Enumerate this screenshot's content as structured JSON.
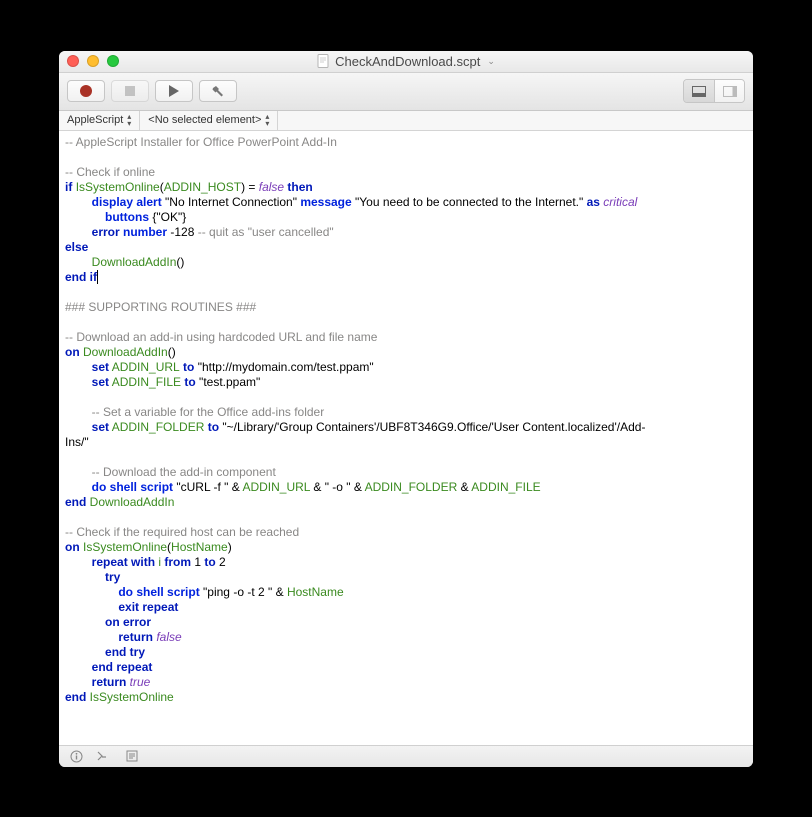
{
  "window": {
    "title": "CheckAndDownload.scpt"
  },
  "subbar": {
    "language": "AppleScript",
    "element": "<No selected element>"
  },
  "code": {
    "l1": "-- AppleScript Installer for Office PowerPoint Add-In",
    "l2": "",
    "l3": "-- Check if online",
    "l4_if": "if",
    "l4_fn": "IsSystemOnline",
    "l4_lp": "(",
    "l4_arg": "ADDIN_HOST",
    "l4_rp": ") = ",
    "l4_false": "false",
    "l4_then": " then",
    "l5_da": "display alert",
    "l5_s1": " \"No Internet Connection\" ",
    "l5_msg": "message",
    "l5_s2": " \"You need to be connected to the Internet.\" ",
    "l5_as": "as",
    "l5_crit": " critical",
    "l6_btn": "buttons",
    "l6_s": " {\"OK\"}",
    "l7_err": "error",
    "l7_num": " number",
    "l7_v": " -128 ",
    "l7_c": "-- quit as \"user cancelled\"",
    "l8": "else",
    "l9_fn": "DownloadAddIn",
    "l9_p": "()",
    "l10": "end if",
    "l11": "",
    "l12": "### SUPPORTING ROUTINES ###",
    "l13": "",
    "l14": "-- Download an add-in using hardcoded URL and file name",
    "l15_on": "on",
    "l15_fn": " DownloadAddIn",
    "l15_p": "()",
    "l16_set": "set",
    "l16_v": " ADDIN_URL",
    "l16_to": " to",
    "l16_s": " \"http://mydomain.com/test.ppam\"",
    "l17_set": "set",
    "l17_v": " ADDIN_FILE",
    "l17_to": " to",
    "l17_s": " \"test.ppam\"",
    "l18": "",
    "l19": "-- Set a variable for the Office add-ins folder",
    "l20_set": "set",
    "l20_v": " ADDIN_FOLDER",
    "l20_to": " to",
    "l20_s": " \"~/Library/'Group Containers'/UBF8T346G9.Office/'User Content.localized'/Add-",
    "l20b": "Ins/\"",
    "l21": "",
    "l22": "-- Download the add-in component",
    "l23_do": "do shell script",
    "l23_s1": " \"cURL -f \" & ",
    "l23_v1": "ADDIN_URL",
    "l23_s2": " & \" -o \" & ",
    "l23_v2": "ADDIN_FOLDER",
    "l23_s3": " & ",
    "l23_v3": "ADDIN_FILE",
    "l24_end": "end",
    "l24_fn": " DownloadAddIn",
    "l25": "",
    "l26": "-- Check if the required host can be reached",
    "l27_on": "on",
    "l27_fn": " IsSystemOnline",
    "l27_lp": "(",
    "l27_arg": "HostName",
    "l27_rp": ")",
    "l28_r": "repeat",
    "l28_w": " with",
    "l28_i": " i",
    "l28_f": " from",
    "l28_1": " 1",
    "l28_t": " to",
    "l28_2": " 2",
    "l29": "try",
    "l30_do": "do shell script",
    "l30_s": " \"ping -o -t 2 \" & ",
    "l30_v": "HostName",
    "l31": "exit repeat",
    "l32": "on error",
    "l33_r": "return",
    "l33_f": " false",
    "l34": "end try",
    "l35": "end repeat",
    "l36_r": "return",
    "l36_t": " true",
    "l37_end": "end",
    "l37_fn": " IsSystemOnline"
  }
}
